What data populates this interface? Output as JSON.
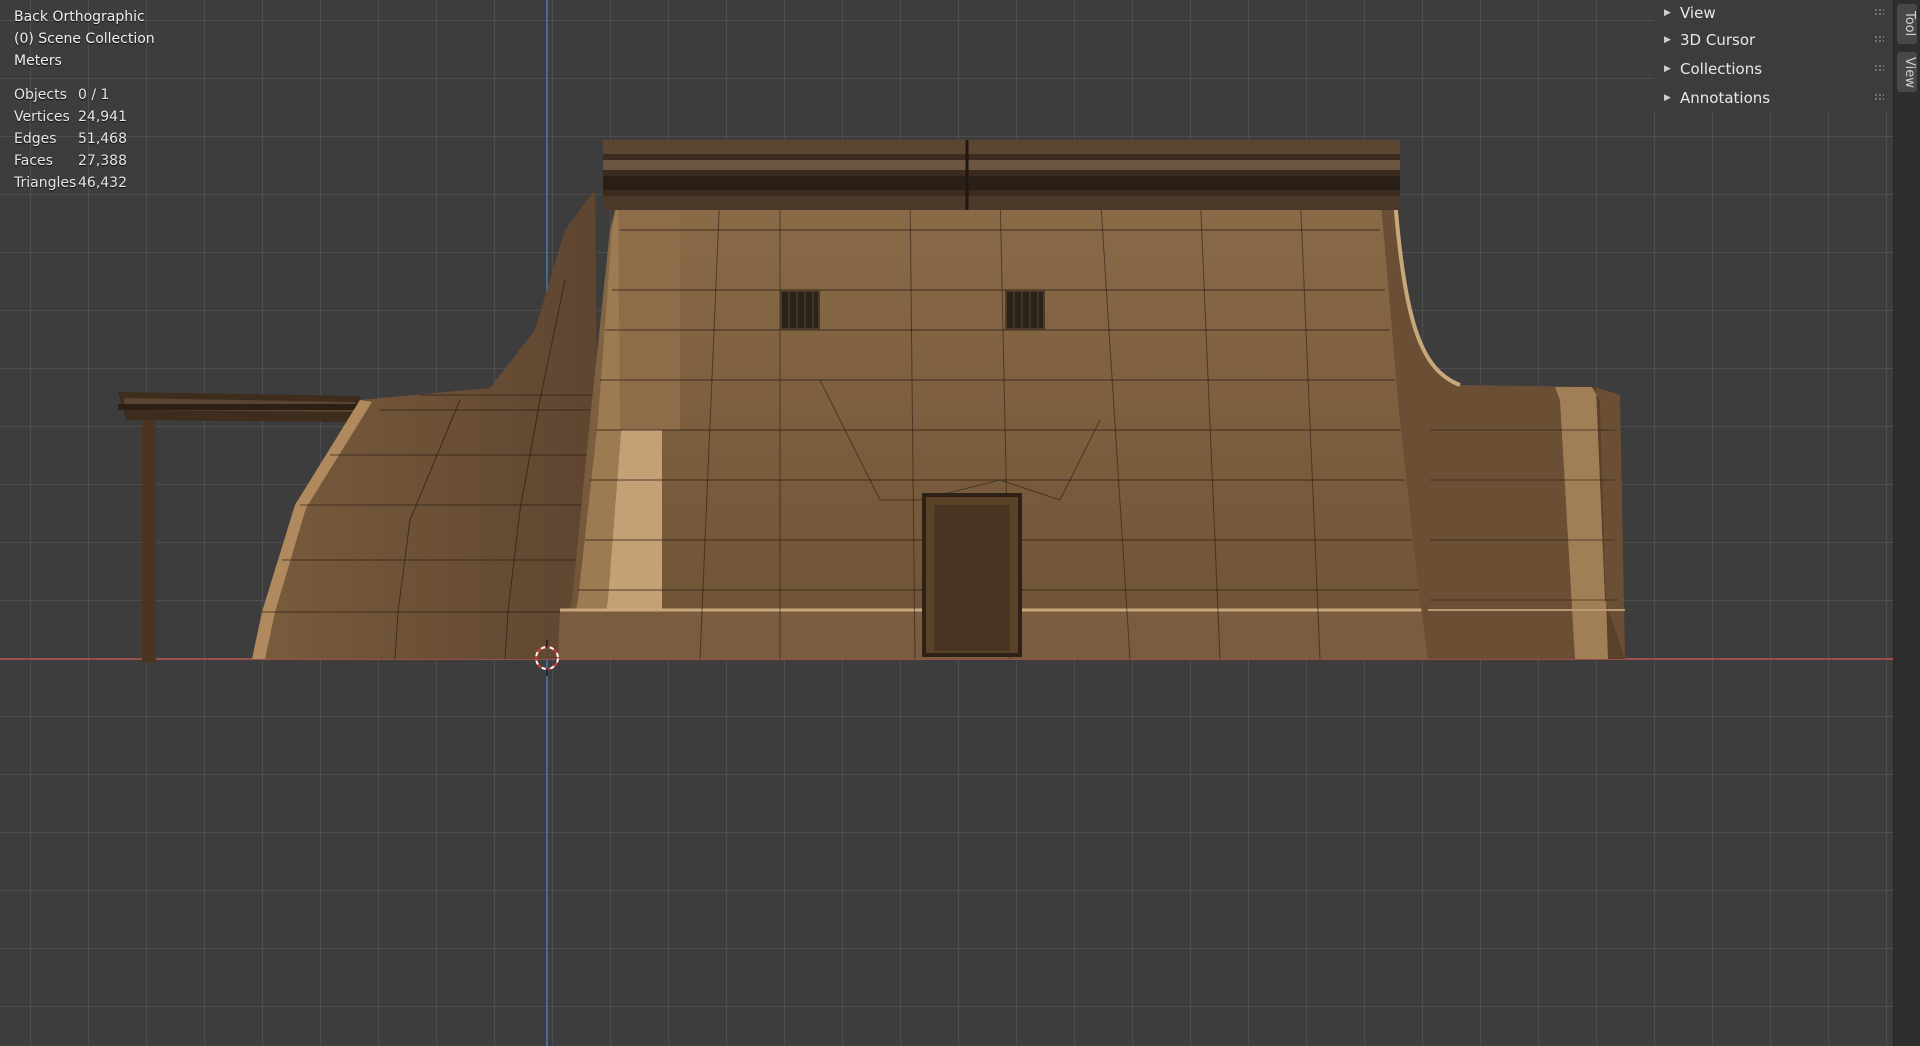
{
  "viewport": {
    "view_name": "Back Orthographic",
    "collection": "(0) Scene Collection",
    "units": "Meters"
  },
  "stats": [
    {
      "label": "Objects",
      "value": "0 / 1"
    },
    {
      "label": "Vertices",
      "value": "24,941"
    },
    {
      "label": "Edges",
      "value": "51,468"
    },
    {
      "label": "Faces",
      "value": "27,388"
    },
    {
      "label": "Triangles",
      "value": "46,432"
    }
  ],
  "sidebar": {
    "panels": [
      "View",
      "3D Cursor",
      "Collections",
      "Annotations"
    ],
    "tabs": [
      "Tool",
      "View"
    ]
  },
  "colors": {
    "background": "#3d3d3d",
    "x_axis": "#c0504d",
    "z_axis": "#4a78b5",
    "wall": "#8a6a47"
  }
}
